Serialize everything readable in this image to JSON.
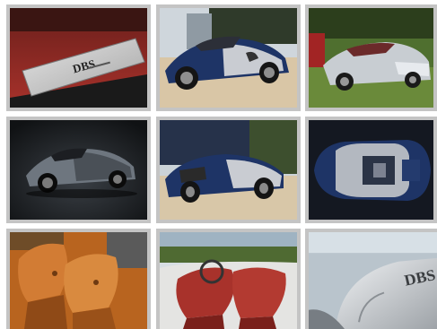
{
  "gallery": {
    "items": [
      {
        "name": "db-s-door-sill-plate",
        "badge_text": "DBS"
      },
      {
        "name": "bugatti-veyron-blue-chrome-front"
      },
      {
        "name": "aston-martin-dbs-volante-silver"
      },
      {
        "name": "bugatti-veyron-dark-grey-studio"
      },
      {
        "name": "bugatti-veyron-blue-chrome-rear"
      },
      {
        "name": "bugatti-veyron-blue-top-view"
      },
      {
        "name": "tan-leather-interior-seats"
      },
      {
        "name": "red-leather-convertible-interior"
      },
      {
        "name": "dbs-badge-closeup",
        "badge_text": "DBS"
      }
    ]
  },
  "colors": {
    "border": "#c4c4c4",
    "red_leather": "#a8322b",
    "tan_leather": "#c8702c",
    "bugatti_blue": "#1e3466",
    "chrome": "#c9ccd2"
  }
}
